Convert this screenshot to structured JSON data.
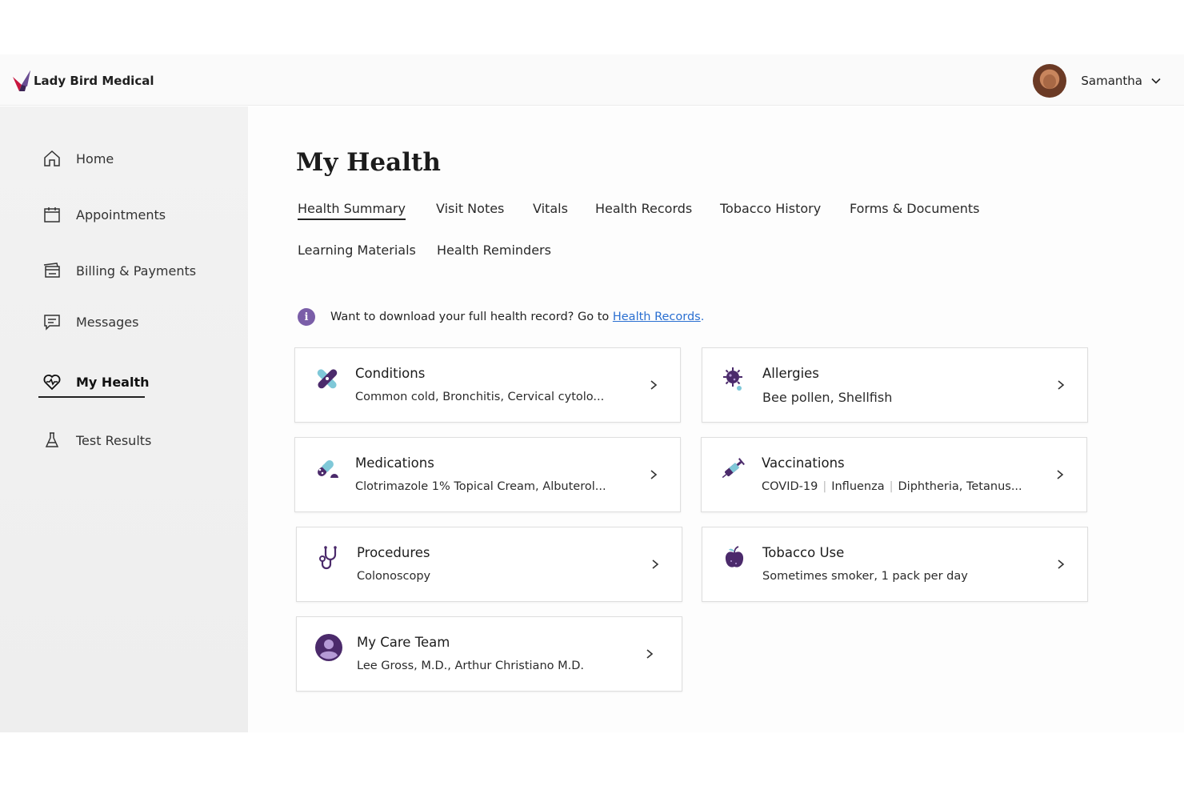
{
  "brand": {
    "name": "Lady Bird Medical"
  },
  "user": {
    "name": "Samantha"
  },
  "sidebar": {
    "items": [
      {
        "label": "Home",
        "icon": "home-icon"
      },
      {
        "label": "Appointments",
        "icon": "calendar-icon"
      },
      {
        "label": "Billing & Payments",
        "icon": "billing-icon"
      },
      {
        "label": "Messages",
        "icon": "message-icon"
      },
      {
        "label": "My Health",
        "icon": "heart-pulse-icon",
        "active": true
      },
      {
        "label": "Test Results",
        "icon": "flask-icon"
      }
    ]
  },
  "main": {
    "title": "My Health",
    "tabs": [
      {
        "label": "Health Summary",
        "active": true
      },
      {
        "label": "Visit Notes"
      },
      {
        "label": "Vitals"
      },
      {
        "label": "Health Records"
      },
      {
        "label": "Tobacco History"
      },
      {
        "label": "Forms & Documents"
      },
      {
        "label": "Learning Materials"
      },
      {
        "label": "Health Reminders"
      }
    ],
    "info": {
      "text": "Want to download your full health record?  Go to ",
      "link": "Health Records",
      "suffix": "."
    },
    "cards": [
      {
        "title": "Conditions",
        "subtitle": "Common cold, Bronchitis, Cervical cytolo...",
        "icon": "bandage-icon"
      },
      {
        "title": "Allergies",
        "subtitle": "Bee pollen, Shellfish",
        "icon": "virus-icon"
      },
      {
        "title": "Medications",
        "subtitle": "Clotrimazole 1% Topical Cream, Albuterol...",
        "icon": "pill-icon"
      },
      {
        "title": "Vaccinations",
        "subtitle_parts": [
          "COVID-19",
          "Influenza",
          "Diphtheria, Tetanus..."
        ],
        "icon": "syringe-icon"
      },
      {
        "title": "Procedures",
        "subtitle": "Colonoscopy",
        "icon": "stethoscope-icon"
      },
      {
        "title": "Tobacco Use",
        "subtitle": "Sometimes smoker, 1 pack per day",
        "icon": "apple-icon"
      },
      {
        "title": "My Care Team",
        "subtitle": "Lee Gross, M.D., Arthur Christiano M.D.",
        "icon": "person-icon"
      }
    ]
  },
  "colors": {
    "accent_purple": "#4b2a6b",
    "accent_teal": "#7fc8d8",
    "link_blue": "#2a6fd1",
    "brand_red": "#c8163f"
  }
}
